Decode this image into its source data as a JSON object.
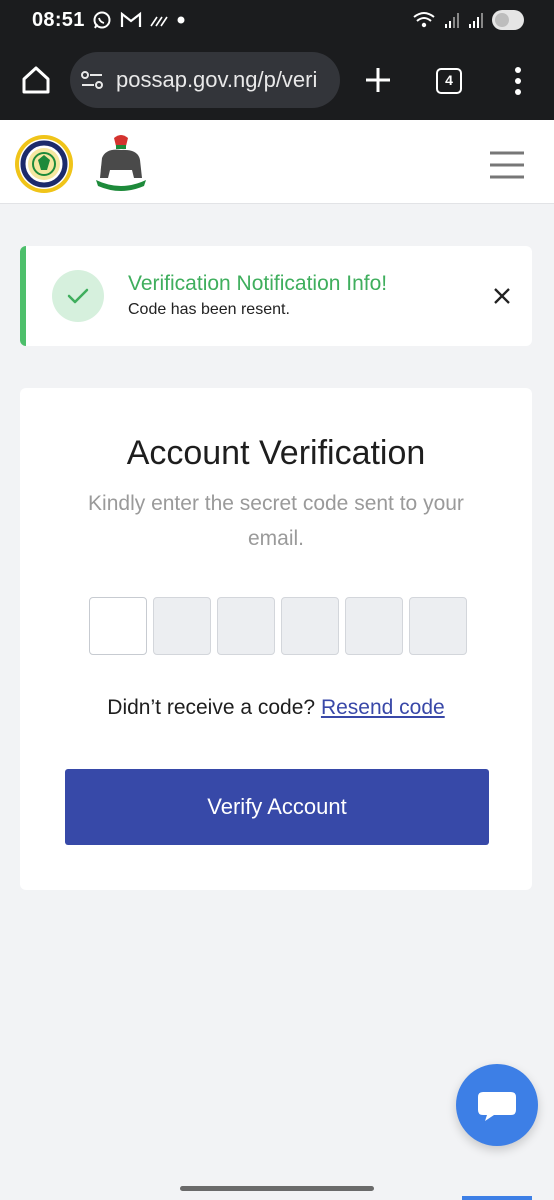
{
  "status_bar": {
    "time": "08:51",
    "left_icons": [
      "whatsapp-icon",
      "gmail-icon",
      "data-saver-icon",
      "dot-icon"
    ],
    "right_icons": [
      "wifi-icon",
      "signal-icon",
      "signal-icon",
      "toggle-icon"
    ]
  },
  "browser": {
    "url": "possap.gov.ng/p/veri",
    "tab_count": "4"
  },
  "alert": {
    "title": "Verification Notification Info!",
    "message": "Code has been resent."
  },
  "card": {
    "title": "Account Verification",
    "subtitle": "Kindly enter the secret code sent to your email.",
    "code_values": [
      "",
      "",
      "",
      "",
      "",
      ""
    ],
    "resend_prompt": "Didn’t receive a code?",
    "resend_link": "Resend code",
    "verify_label": "Verify Account"
  },
  "colors": {
    "accent": "#3749a8",
    "success": "#3fae5d",
    "chat": "#3d7fe6"
  }
}
